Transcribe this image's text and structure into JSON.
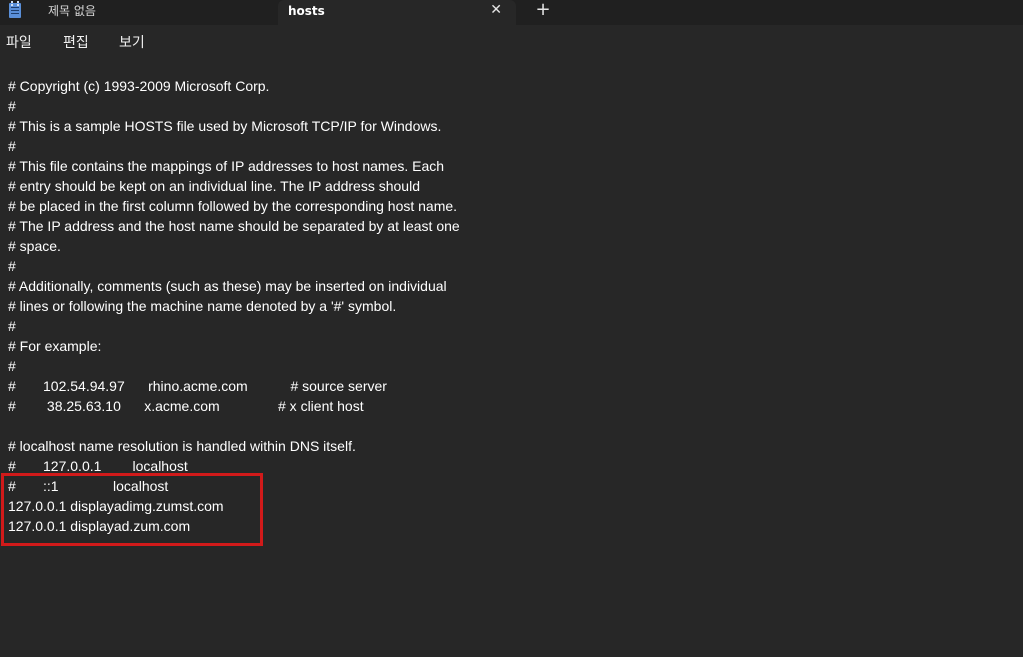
{
  "tabs": [
    {
      "label": "제목 없음",
      "active": false
    },
    {
      "label": "hosts",
      "active": true
    }
  ],
  "tab_close_glyph": "✕",
  "new_tab_glyph": "+",
  "menu": {
    "file": "파일",
    "edit": "편집",
    "view": "보기"
  },
  "editor_lines": [
    "# Copyright (c) 1993-2009 Microsoft Corp.",
    "#",
    "# This is a sample HOSTS file used by Microsoft TCP/IP for Windows.",
    "#",
    "# This file contains the mappings of IP addresses to host names. Each",
    "# entry should be kept on an individual line. The IP address should",
    "# be placed in the first column followed by the corresponding host name.",
    "# The IP address and the host name should be separated by at least one",
    "# space.",
    "#",
    "# Additionally, comments (such as these) may be inserted on individual",
    "# lines or following the machine name denoted by a '#' symbol.",
    "#",
    "# For example:",
    "#",
    "#       102.54.94.97      rhino.acme.com           # source server",
    "#        38.25.63.10      x.acme.com               # x client host",
    "",
    "# localhost name resolution is handled within DNS itself.",
    "#       127.0.0.1        localhost",
    "#       ::1              localhost",
    "127.0.0.1 displayadimg.zumst.com",
    "127.0.0.1 displayad.zum.com"
  ],
  "colors": {
    "highlight_box": "#d11a1a",
    "background": "#272727",
    "tabbar": "#202020"
  },
  "icons": {
    "app": "notepad-icon"
  }
}
